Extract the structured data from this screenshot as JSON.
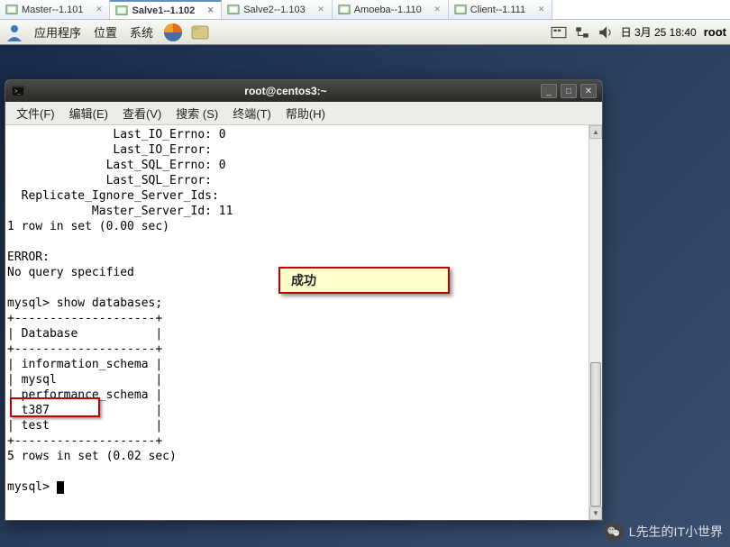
{
  "tabs": [
    {
      "label": "Master--1.101",
      "active": false
    },
    {
      "label": "Salve1--1.102",
      "active": true
    },
    {
      "label": "Salve2--1.103",
      "active": false
    },
    {
      "label": "Amoeba--1.110",
      "active": false
    },
    {
      "label": "Client--1.111",
      "active": false
    }
  ],
  "panel": {
    "apps": "应用程序",
    "places": "位置",
    "system": "系统",
    "datetime": "日 3月 25 18:40",
    "user": "root"
  },
  "window": {
    "title": "root@centos3:~",
    "menus": {
      "file": "文件(F)",
      "edit": "编辑(E)",
      "view": "查看(V)",
      "search": "搜索 (S)",
      "terminal": "终端(T)",
      "help": "帮助(H)"
    }
  },
  "terminal": {
    "lines": [
      "               Last_IO_Errno: 0",
      "               Last_IO_Error:",
      "              Last_SQL_Errno: 0",
      "              Last_SQL_Error:",
      "  Replicate_Ignore_Server_Ids:",
      "            Master_Server_Id: 11",
      "1 row in set (0.00 sec)",
      "",
      "ERROR:",
      "No query specified",
      "",
      "mysql> show databases;",
      "+--------------------+",
      "| Database           |",
      "+--------------------+",
      "| information_schema |",
      "| mysql              |",
      "| performance_schema |",
      "| t387               |",
      "| test               |",
      "+--------------------+",
      "5 rows in set (0.02 sec)",
      "",
      "mysql> "
    ]
  },
  "annotation": {
    "success": "成功"
  },
  "watermark": "L先生的IT小世界"
}
